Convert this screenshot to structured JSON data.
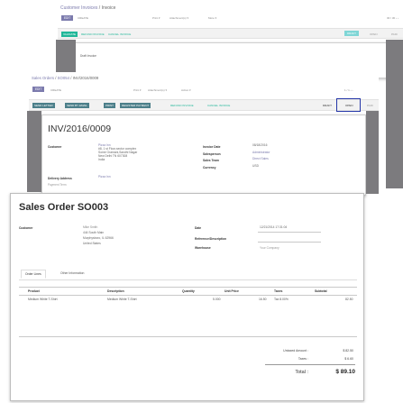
{
  "back": {
    "breadcrumb_parent": "Customer Invoices",
    "breadcrumb_sep": " / ",
    "breadcrumb_current": "Invoice",
    "edit_label": "EDIT",
    "create_label": "CREATE",
    "print_label": "Print ▾",
    "attachments_label": "Attachment(s) ▾",
    "more_label": "More ▾",
    "pager": "30 / 30  ‹  ›",
    "validate_label": "VALIDATE",
    "refund_label": "REFUND INVOICE",
    "cancel_label": "CANCEL INVOICE",
    "stage_draft": "DRAFT",
    "stage_open": "OPEN",
    "stage_paid": "PAID",
    "doc_title": "Draft Invoice"
  },
  "mid": {
    "breadcrumb_1": "Sales Orders",
    "breadcrumb_2": "SO054",
    "breadcrumb_3": "INV/2016/0009",
    "edit_label": "EDIT",
    "create_label": "CREATE",
    "print_label": "Print ▾",
    "attachments_label": "Attachment(s) ▾",
    "action_label": "Action ▾",
    "pager": "1 / 1  ‹  ›",
    "send_letter": "SEND LETTER",
    "send_email": "SEND BY EMAIL",
    "print_btn": "PRINT",
    "register_payment": "REGISTER PAYMENT",
    "refund_label": "REFUND INVOICE",
    "cancel_label": "CANCEL INVOICE",
    "stage_draft": "DRAFT",
    "stage_open": "OPEN",
    "stage_paid": "PAID",
    "doc_title": "INV/2016/0009",
    "customer_label": "Customer",
    "customer_name": "Pizza Inn",
    "customer_addr_1": "#8, 1 st Floor,sector complex",
    "customer_addr_2": "Some Gramani,Sandhi Nagar",
    "customer_addr_3": "New Delhi TN 607308",
    "customer_addr_4": "India",
    "invoice_date_label": "Invoice Date",
    "invoice_date": "08/18/2016",
    "salesperson_label": "Salesperson",
    "salesperson": "Administrator",
    "sales_team_label": "Sales Team",
    "sales_team": "Direct Sales",
    "currency_label": "Currency",
    "currency": "USD",
    "delivery_label": "Delivery Address",
    "delivery_value": "Pizza Inn",
    "payment_terms_label": "Payment Term"
  },
  "front": {
    "title_prefix": "Sales Order ",
    "title_number": "SO003",
    "customer_label": "Customer",
    "customer_name": "Mike Smith",
    "customer_addr_1": "444 South Main",
    "customer_addr_2": "Murphysboro, IL 62966",
    "customer_addr_3": "United States",
    "date_label": "Date",
    "date_value": "12/21/2014 17:31:04",
    "reference_label": "Reference/Description",
    "warehouse_label": "Warehouse",
    "warehouse_value": "Your Company",
    "tab_order_lines": "Order Lines",
    "tab_other": "Other Information",
    "columns": [
      "Product",
      "Description",
      "Quantity",
      "Unit Price",
      "Taxes",
      "Subtotal"
    ],
    "row": {
      "product": "Medium White T-Shirt",
      "description": "Medium White T-Shirt",
      "quantity": "5.000",
      "unit_price": "16.50",
      "taxes": "Tax 8.00%",
      "subtotal": "82.50"
    },
    "untaxed_label": "Untaxed Amount :",
    "untaxed_value": "$ 82.50",
    "taxes_label": "Taxes :",
    "taxes_value": "$ 6.60",
    "total_label": "Total :",
    "total_value": "$ 89.10"
  },
  "colors": {
    "brand": "#7c7bad",
    "teal": "#21b799",
    "gray_frame": "#7c7b7e",
    "highlight_box": "#2536a8"
  }
}
